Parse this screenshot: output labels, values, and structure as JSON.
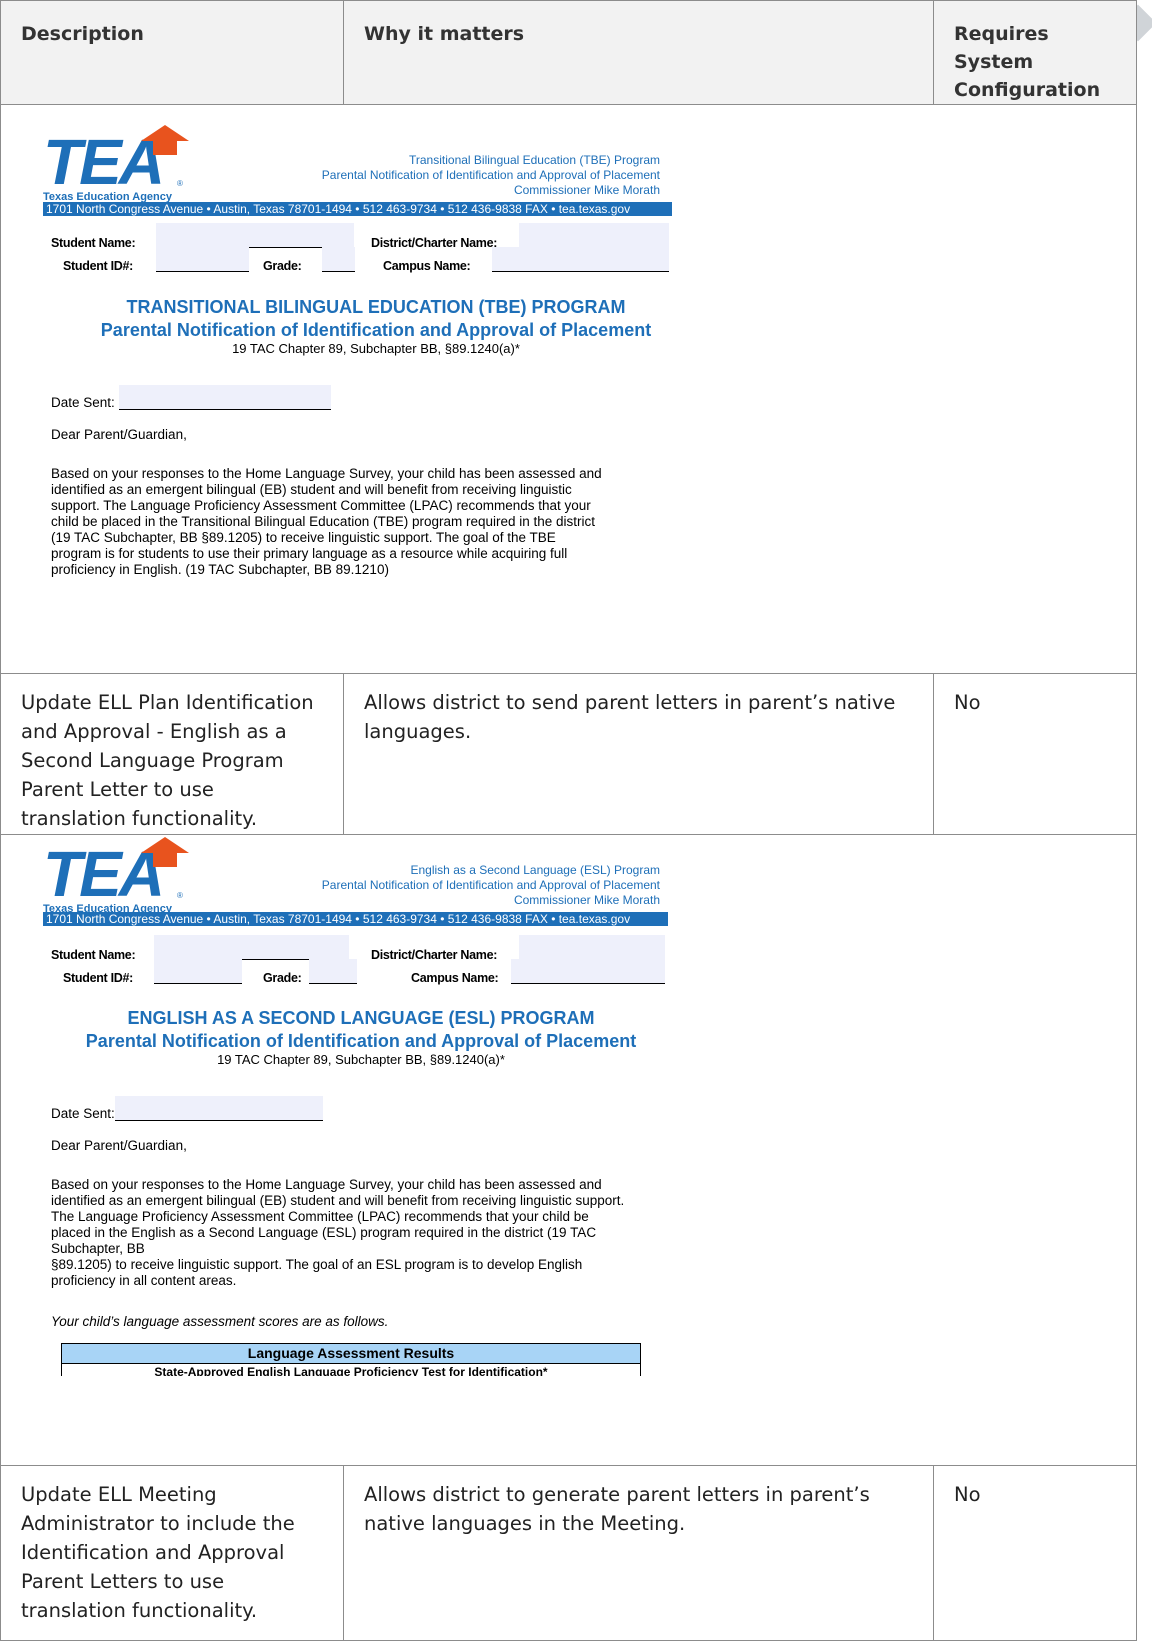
{
  "table": {
    "headers": [
      "Description",
      "Why it matters",
      "Requires System Configuration"
    ],
    "rows": [
      {
        "description": "Update ELL Plan Identification and Approval - English as a Second Language Program Parent Letter to use translation functionality.",
        "why": "Allows district to send parent letters in parent’s native languages.",
        "config": "No"
      },
      {
        "description": "Update ELL Meeting Administrator to include the Identification and Approval Parent Letters to use translation functionality.",
        "why": "Allows district to generate parent letters in parent’s native languages in the Meeting.",
        "config": "No"
      }
    ]
  },
  "letter_common": {
    "logo_text": "TEA",
    "agency": "Texas Education Agency",
    "commissioner": "Commissioner Mike Morath",
    "address_bar": "1701 North Congress Avenue • Austin, Texas 78701-1494 • 512 463-9734 • 512 436-9838 FAX • tea.texas.gov",
    "student_name_label": "Student Name:",
    "district_label": "District/Charter Name:",
    "student_id_label": "Student ID#:",
    "grade_label": "Grade:",
    "campus_label": "Campus Name:",
    "campus_label_esl": "Campus Name:",
    "subtitle": "Parental Notification of Identification and Approval of Placement",
    "ref": "19 TAC Chapter 89, Subchapter BB, §89.1240(a)*",
    "date_label": "Date Sent:",
    "salutation": "Dear Parent/Guardian,"
  },
  "letter_tbe": {
    "program_line": "Transitional Bilingual Education (TBE) Program",
    "notification_line": "Parental Notification of Identification and Approval of Placement",
    "title": "TRANSITIONAL BILINGUAL EDUCATION (TBE) PROGRAM",
    "body": [
      "Based on your responses to the Home Language Survey, your child has been assessed and",
      "identified as an emergent bilingual (EB) student and will benefit from receiving linguistic",
      "support.  The Language Proficiency Assessment Committee (LPAC) recommends that your",
      "child be placed in the Transitional Bilingual Education (TBE) program required in the district",
      "(19 TAC Subchapter, BB §89.1205) to receive linguistic support. The goal of the TBE",
      "program is for students to use their primary language as a resource while acquiring full",
      "proficiency in English. (19 TAC Subchapter, BB 89.1210)"
    ]
  },
  "letter_esl": {
    "program_line": "English as a Second Language (ESL) Program",
    "notification_line": "Parental Notification of Identification and Approval of Placement",
    "title": "ENGLISH AS A SECOND LANGUAGE (ESL) PROGRAM",
    "body": [
      "Based on your responses to the Home Language Survey, your child has been assessed and",
      "identified as an emergent bilingual (EB) student and will benefit from receiving linguistic support.",
      "The Language Proficiency Assessment Committee (LPAC) recommends that your child be",
      "placed in the English as a Second Language (ESL) program required in the district (19 TAC",
      "Subchapter, BB",
      "§89.1205) to receive linguistic support. The goal of an ESL program is to develop English",
      "proficiency in all content areas."
    ],
    "scores_intro": "Your child’s language assessment scores are as follows.",
    "results_title": "Language Assessment Results",
    "results_sub": "State-Approved English Language Proficiency Test for Identification*"
  }
}
